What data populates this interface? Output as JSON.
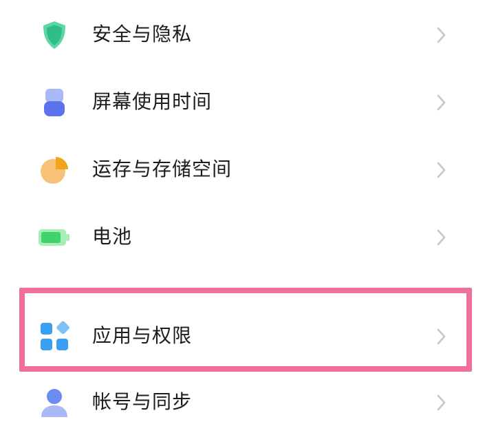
{
  "settings": {
    "items": [
      {
        "label": "安全与隐私",
        "icon": "shield-icon"
      },
      {
        "label": "屏幕使用时间",
        "icon": "hourglass-icon"
      },
      {
        "label": "运存与存储空间",
        "icon": "pie-chart-icon"
      },
      {
        "label": "电池",
        "icon": "battery-icon"
      },
      {
        "label": "应用与权限",
        "icon": "apps-grid-icon"
      },
      {
        "label": "帐号与同步",
        "icon": "account-icon"
      }
    ]
  },
  "colors": {
    "highlight_border": "#ef6f97",
    "chevron": "#c7c7c7",
    "text": "#1c1c1c"
  }
}
